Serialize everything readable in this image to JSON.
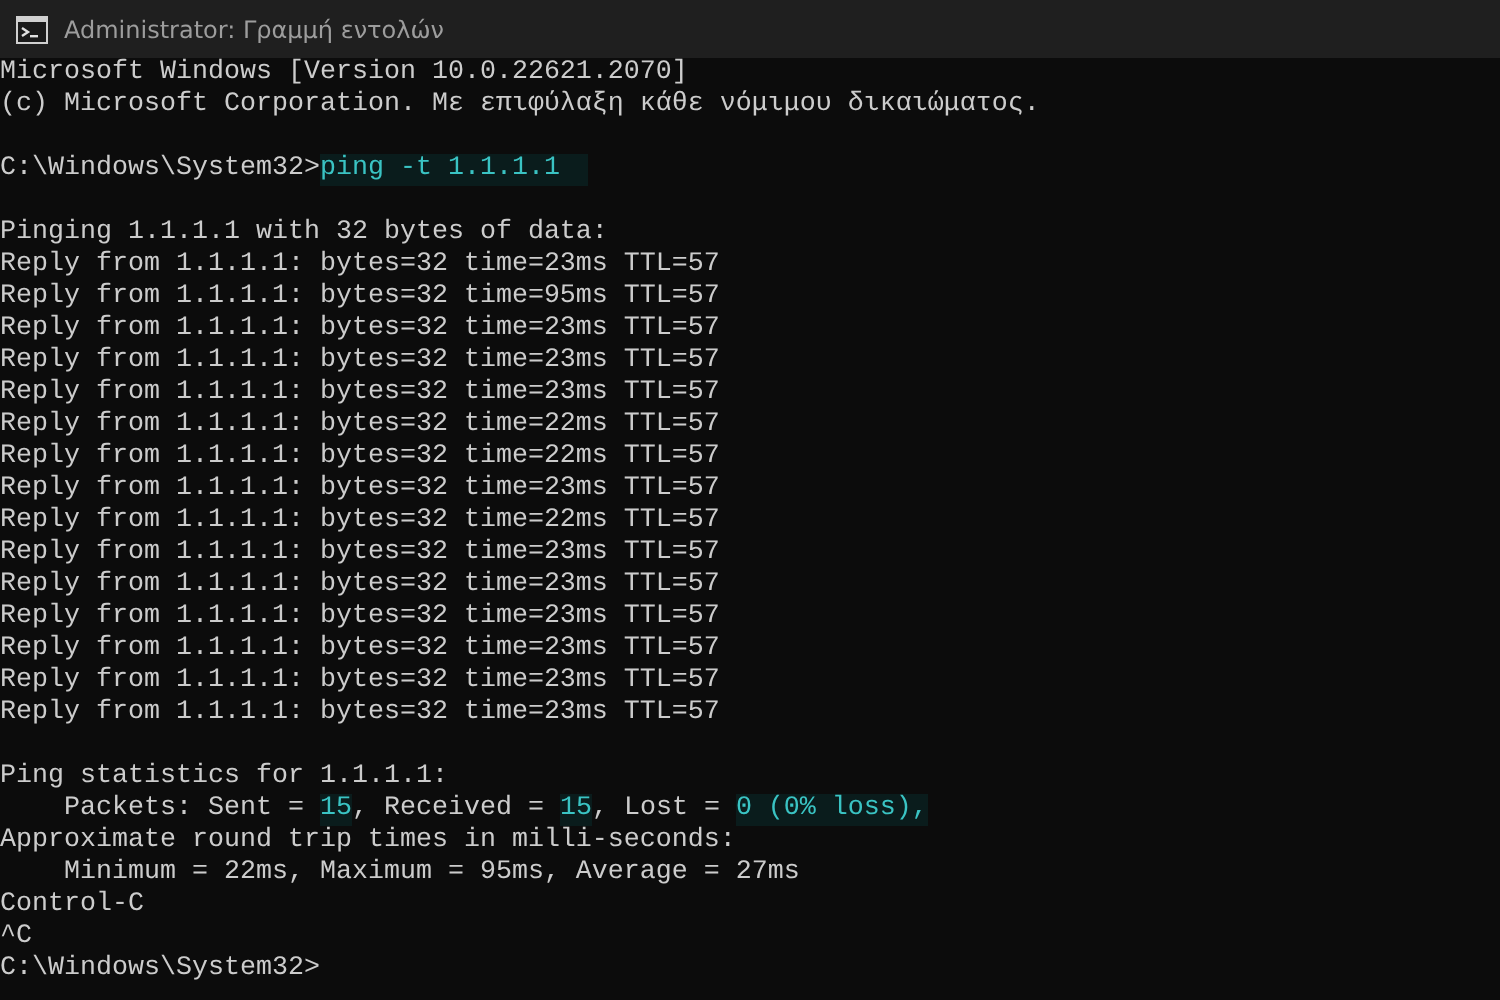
{
  "window": {
    "title": "Administrator: Γραμμή εντολών"
  },
  "console": {
    "lines": [
      {
        "kind": "text",
        "segments": [
          {
            "kind": "plain",
            "text": "Microsoft Windows [Version 10.0.22621.2070]"
          }
        ]
      },
      {
        "kind": "text",
        "segments": [
          {
            "kind": "plain",
            "text": "(c) Microsoft Corporation. Με επιφύλαξη κάθε νόμιμου δικαιώματος."
          }
        ]
      },
      {
        "kind": "blank"
      },
      {
        "kind": "text",
        "segments": [
          {
            "kind": "plain",
            "text": "C:\\Windows\\System32>"
          },
          {
            "kind": "input",
            "text": "ping -t 1.1.1.1"
          }
        ]
      },
      {
        "kind": "blank"
      },
      {
        "kind": "text",
        "segments": [
          {
            "kind": "plain",
            "text": "Pinging 1.1.1.1 with 32 bytes of data:"
          }
        ]
      },
      {
        "kind": "text",
        "segments": [
          {
            "kind": "plain",
            "text": "Reply from 1.1.1.1: bytes=32 time=23ms TTL=57"
          }
        ]
      },
      {
        "kind": "text",
        "segments": [
          {
            "kind": "plain",
            "text": "Reply from 1.1.1.1: bytes=32 time=95ms TTL=57"
          }
        ]
      },
      {
        "kind": "text",
        "segments": [
          {
            "kind": "plain",
            "text": "Reply from 1.1.1.1: bytes=32 time=23ms TTL=57"
          }
        ]
      },
      {
        "kind": "text",
        "segments": [
          {
            "kind": "plain",
            "text": "Reply from 1.1.1.1: bytes=32 time=23ms TTL=57"
          }
        ]
      },
      {
        "kind": "text",
        "segments": [
          {
            "kind": "plain",
            "text": "Reply from 1.1.1.1: bytes=32 time=23ms TTL=57"
          }
        ]
      },
      {
        "kind": "text",
        "segments": [
          {
            "kind": "plain",
            "text": "Reply from 1.1.1.1: bytes=32 time=22ms TTL=57"
          }
        ]
      },
      {
        "kind": "text",
        "segments": [
          {
            "kind": "plain",
            "text": "Reply from 1.1.1.1: bytes=32 time=22ms TTL=57"
          }
        ]
      },
      {
        "kind": "text",
        "segments": [
          {
            "kind": "plain",
            "text": "Reply from 1.1.1.1: bytes=32 time=23ms TTL=57"
          }
        ]
      },
      {
        "kind": "text",
        "segments": [
          {
            "kind": "plain",
            "text": "Reply from 1.1.1.1: bytes=32 time=22ms TTL=57"
          }
        ]
      },
      {
        "kind": "text",
        "segments": [
          {
            "kind": "plain",
            "text": "Reply from 1.1.1.1: bytes=32 time=23ms TTL=57"
          }
        ]
      },
      {
        "kind": "text",
        "segments": [
          {
            "kind": "plain",
            "text": "Reply from 1.1.1.1: bytes=32 time=23ms TTL=57"
          }
        ]
      },
      {
        "kind": "text",
        "segments": [
          {
            "kind": "plain",
            "text": "Reply from 1.1.1.1: bytes=32 time=23ms TTL=57"
          }
        ]
      },
      {
        "kind": "text",
        "segments": [
          {
            "kind": "plain",
            "text": "Reply from 1.1.1.1: bytes=32 time=23ms TTL=57"
          }
        ]
      },
      {
        "kind": "text",
        "segments": [
          {
            "kind": "plain",
            "text": "Reply from 1.1.1.1: bytes=32 time=23ms TTL=57"
          }
        ]
      },
      {
        "kind": "text",
        "segments": [
          {
            "kind": "plain",
            "text": "Reply from 1.1.1.1: bytes=32 time=23ms TTL=57"
          }
        ]
      },
      {
        "kind": "blank"
      },
      {
        "kind": "text",
        "segments": [
          {
            "kind": "plain",
            "text": "Ping statistics for 1.1.1.1:"
          }
        ]
      },
      {
        "kind": "text",
        "segments": [
          {
            "kind": "plain",
            "text": "    Packets: Sent = "
          },
          {
            "kind": "highlight",
            "text": "15"
          },
          {
            "kind": "plain",
            "text": ", Received = "
          },
          {
            "kind": "highlight",
            "text": "15"
          },
          {
            "kind": "plain",
            "text": ", Lost = "
          },
          {
            "kind": "highlight",
            "text": "0 (0% loss),"
          }
        ]
      },
      {
        "kind": "text",
        "segments": [
          {
            "kind": "plain",
            "text": "Approximate round trip times in milli-seconds:"
          }
        ]
      },
      {
        "kind": "text",
        "segments": [
          {
            "kind": "plain",
            "text": "    Minimum = 22ms, Maximum = 95ms, Average = 27ms"
          }
        ]
      },
      {
        "kind": "text",
        "segments": [
          {
            "kind": "plain",
            "text": "Control-C"
          }
        ]
      },
      {
        "kind": "text",
        "segments": [
          {
            "kind": "plain",
            "text": "^C"
          }
        ]
      },
      {
        "kind": "text",
        "segments": [
          {
            "kind": "plain",
            "text": "C:\\Windows\\System32>"
          }
        ]
      }
    ]
  }
}
